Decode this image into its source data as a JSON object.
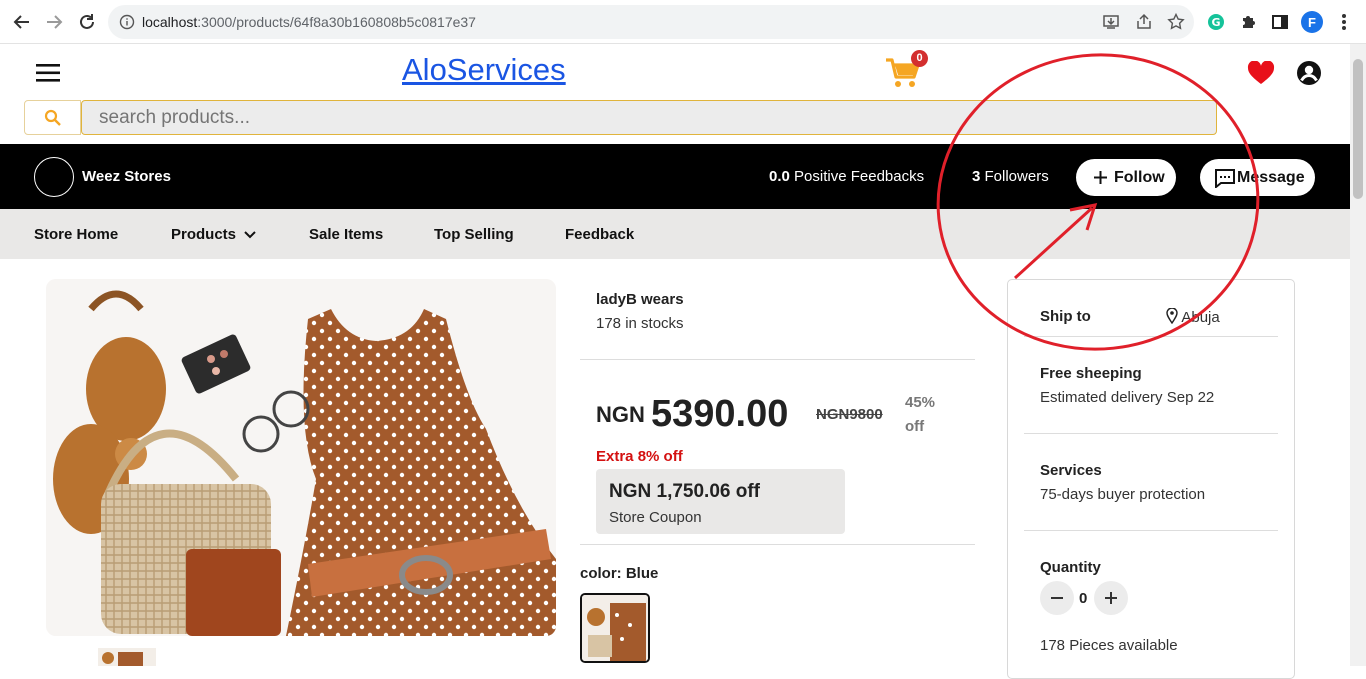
{
  "browser": {
    "url_host": "localhost",
    "url_path": ":3000/products/64f8a30b160808b5c0817e37",
    "profile_initial": "F"
  },
  "header": {
    "logo": "AloServices",
    "cart_count": "0",
    "search_placeholder": "search products..."
  },
  "store": {
    "name": "Weez Stores",
    "feedback_value": "0.0",
    "feedback_label": "Positive Feedbacks",
    "followers_value": "3",
    "followers_label": "Followers",
    "follow_label": "Follow",
    "message_label": "Message"
  },
  "subnav": {
    "home": "Store Home",
    "products": "Products",
    "sale": "Sale Items",
    "top": "Top Selling",
    "feedback": "Feedback"
  },
  "product": {
    "seller": "ladyB wears",
    "stock": "178 in stocks",
    "currency": "NGN",
    "price": "5390.00",
    "old_price": "NGN9800",
    "discount_pct": "45%",
    "discount_word": "off",
    "extra_off": "Extra 8% off",
    "coupon_amount": "NGN 1,750.06 off",
    "coupon_label": "Store Coupon",
    "color_label": "color: Blue"
  },
  "shipping": {
    "ship_to_label": "Ship to",
    "ship_to_city": "Abuja",
    "free_title": "Free sheeping",
    "delivery": "Estimated delivery Sep 22",
    "services_title": "Services",
    "services_desc": "75-days buyer protection",
    "quantity_title": "Quantity",
    "quantity_value": "0",
    "pieces": "178 Pieces available"
  },
  "colors": {
    "brand_blue": "#1a55e3",
    "cart_orange": "#f5a623",
    "heart_red": "#e8101a",
    "annotation_red": "#e0202a",
    "extra_red": "#d41111"
  }
}
